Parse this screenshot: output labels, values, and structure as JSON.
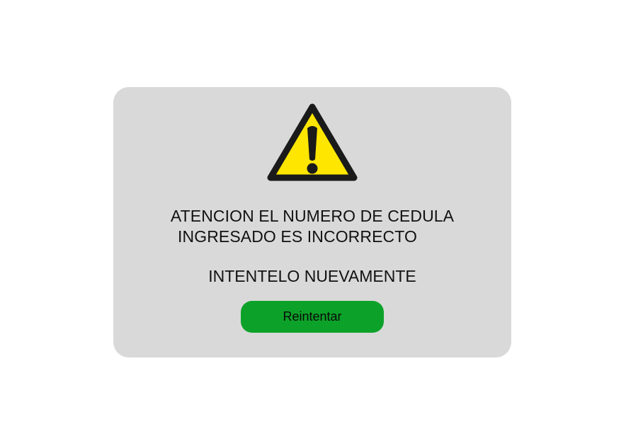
{
  "dialog": {
    "icon": "warning-triangle-icon",
    "message_line1": "ATENCION EL NUMERO DE CEDULA",
    "message_line2": "INGRESADO ES INCORRECTO",
    "retry_message": "INTENTELO NUEVAMENTE",
    "retry_button_label": "Reintentar"
  },
  "colors": {
    "dialog_background": "#d9d9d9",
    "button_background": "#0ca229",
    "warning_yellow": "#ffe600",
    "warning_outline": "#1a1a1a"
  }
}
